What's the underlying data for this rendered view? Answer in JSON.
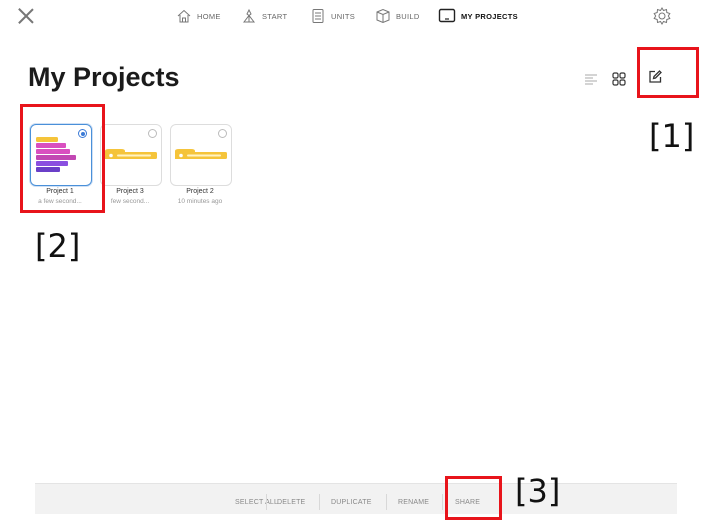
{
  "nav": {
    "close_icon": "close-icon",
    "items": [
      {
        "label": "HOME",
        "icon": "home-icon"
      },
      {
        "label": "START",
        "icon": "start-icon"
      },
      {
        "label": "UNITS",
        "icon": "units-icon"
      },
      {
        "label": "BUILD",
        "icon": "build-icon"
      },
      {
        "label": "MY PROJECTS",
        "icon": "tablet-icon",
        "active": true
      }
    ],
    "settings_icon": "gear-icon"
  },
  "page": {
    "title": "My Projects"
  },
  "view_controls": {
    "list_icon": "list-view-icon",
    "grid_icon": "grid-view-icon",
    "edit_icon": "edit-icon"
  },
  "projects": [
    {
      "name": "Project 1",
      "time": "a few second...",
      "selected": true
    },
    {
      "name": "Project 3",
      "time": "few second...",
      "selected": false
    },
    {
      "name": "Project 2",
      "time": "10 minutes ago",
      "selected": false
    }
  ],
  "actions": [
    "SELECT ALL",
    "DELETE",
    "DUPLICATE",
    "RENAME",
    "SHARE"
  ],
  "annotations": {
    "a1": "[1]",
    "a2": "[2]",
    "a3": "[3]"
  },
  "colors": {
    "annotation_box": "#e8141b",
    "selection": "#3c7bd6",
    "block_yellow": "#f5c43a",
    "block_pink": "#d94fc0",
    "block_purple": "#8a4fe0"
  }
}
